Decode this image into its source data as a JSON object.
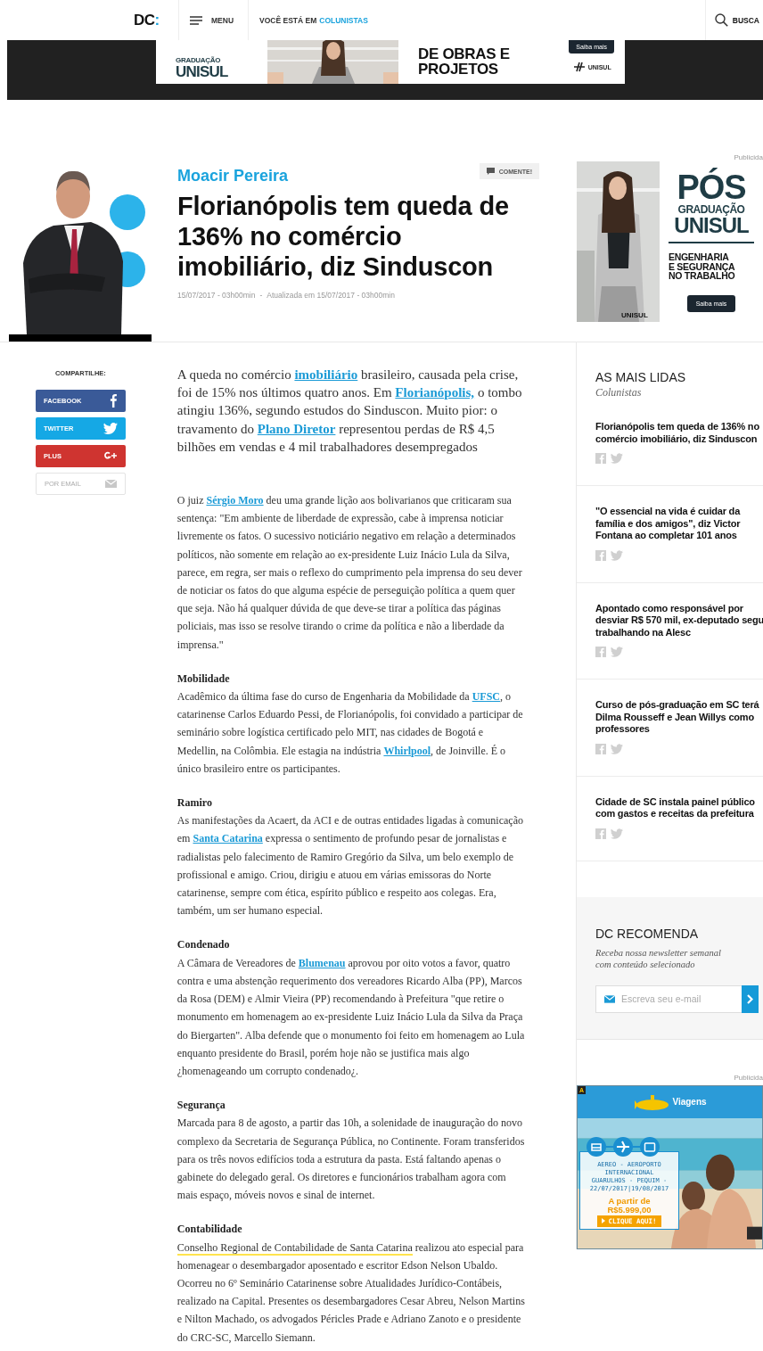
{
  "top_nav": {
    "logo": "DC",
    "logo_mark": ":",
    "menu": "MENU",
    "breadcrumb_prefix": "VOCÊ ESTÁ EM",
    "breadcrumb": "COLUNISTAS",
    "search": "BUSCA"
  },
  "top_banner": {
    "school_lines": [
      "GRADUAÇÃO",
      "UNISUL"
    ],
    "headline_lines": [
      "DE OBRAS E",
      "PROJETOS"
    ],
    "button": "Saiba mais",
    "brand": "UNISUL"
  },
  "article_header": {
    "author": "Moacir Pereira",
    "comment_button": "COMENTE!",
    "title": "Florianópolis tem queda de 136% no comércio imobiliário, diz Sinduscon",
    "published": "15/07/2017 - 03h00min",
    "separator": "-",
    "updated": "Atualizada em 15/07/2017 - 03h00min"
  },
  "side_ad": {
    "label": "Publicida",
    "big": "PÓS",
    "lines": [
      "GRADUAÇÃO",
      "UNISUL"
    ],
    "subtitle_lines": [
      "ENGENHARIA",
      "E SEGURANÇA",
      "NO TRABALHO"
    ],
    "button": "Saiba mais",
    "brand": "UNISUL"
  },
  "share": {
    "title": "COMPARTILHE:",
    "buttons": [
      {
        "label": "FACEBOOK",
        "kind": "facebook"
      },
      {
        "label": "TWITTER",
        "kind": "twitter"
      },
      {
        "label": "PLUS",
        "kind": "plus"
      },
      {
        "label": "POR EMAIL",
        "kind": "email"
      }
    ]
  },
  "article": {
    "lead": [
      {
        "kind": "text",
        "text": "A queda no comércio "
      },
      {
        "kind": "link",
        "text": "imobiliário"
      },
      {
        "kind": "text",
        "text": " brasileiro, causada pela crise, foi de 15% nos últimos quatro anos. Em "
      },
      {
        "kind": "link",
        "text": "Florianópolis,"
      },
      {
        "kind": "text",
        "text": " o tombo atingiu 136%, segundo estudos do Sinduscon. Muito pior: o travamento do "
      },
      {
        "kind": "link",
        "text": "Plano Diretor"
      },
      {
        "kind": "text",
        "text": " representou perdas de R$ 4,5 bilhões em vendas e 4 mil trabalhadores desempregados"
      }
    ],
    "sections": [
      {
        "parts": [
          {
            "kind": "text",
            "text": "O juiz "
          },
          {
            "kind": "link",
            "text": "Sérgio Moro"
          },
          {
            "kind": "text",
            "text": " deu uma grande lição aos bolivarianos que criticaram sua sentença: \"Em ambiente de liberdade de expressão, cabe à imprensa noticiar livremente os fatos. O sucessivo noticiário negativo em relação a determinados políticos, não somente em relação ao ex-presidente Luiz Inácio Lula da Silva, parece, em regra, ser mais o reflexo do cumprimento pela imprensa do seu dever de noticiar os fatos do que alguma espécie de perseguição política a quem quer que seja. Não há qualquer dúvida de que deve-se tirar a política das páginas policiais, mas isso se resolve tirando o crime da política e não a liberdade da imprensa.\""
          }
        ]
      },
      {
        "heading": "Mobilidade",
        "parts": [
          {
            "kind": "text",
            "text": "Acadêmico da última fase do curso de Engenharia da Mobilidade da "
          },
          {
            "kind": "link",
            "text": "UFSC"
          },
          {
            "kind": "text",
            "text": ", o catarinense Carlos Eduardo Pessi, de Florianópolis, foi convidado a participar de seminário sobre logística certificado pelo MIT, nas cidades de Bogotá e Medellin, na Colômbia. Ele estagia na indústria "
          },
          {
            "kind": "link",
            "text": "Whirlpool"
          },
          {
            "kind": "text",
            "text": ", de Joinville. É o único brasileiro entre os participantes."
          }
        ]
      },
      {
        "heading": "Ramiro",
        "parts": [
          {
            "kind": "text",
            "text": "As manifestações da Acaert, da ACI e de outras entidades ligadas à comunicação em "
          },
          {
            "kind": "link",
            "text": "Santa Catarina"
          },
          {
            "kind": "text",
            "text": " expressa o sentimento de profundo pesar de jornalistas e radialistas pelo falecimento de Ramiro Gregório da Silva, um belo exemplo de profissional e amigo. Criou, dirigiu e atuou em várias emissoras do Norte catarinense, sempre com ética, espírito público e respeito aos colegas. Era, também, um ser humano especial."
          }
        ]
      },
      {
        "heading": "Condenado",
        "parts": [
          {
            "kind": "text",
            "text": "A Câmara de Vereadores de "
          },
          {
            "kind": "link",
            "text": "Blumenau"
          },
          {
            "kind": "text",
            "text": " aprovou por oito votos a favor, quatro contra e uma abstenção requerimento dos vereadores Ricardo Alba (PP), Marcos da Rosa (DEM) e Almir Vieira (PP) recomendando à Prefeitura \"que retire o monumento em homenagem ao ex-presidente Luiz Inácio Lula da Silva da Praça do Biergarten\". Alba defende que o monumento foi feito em homenagem ao Lula enquanto presidente do Brasil, porém hoje não se justifica mais algo ¿homenageando um corrupto condenado¿."
          }
        ]
      },
      {
        "heading": "Segurança",
        "parts": [
          {
            "kind": "text",
            "text": "Marcada para 8 de agosto, a partir das 10h, a solenidade de inauguração do novo complexo da Secretaria de Segurança Pública, no Continente. Foram transferidos para os três novos edifícios toda a estrutura da pasta. Está faltando apenas o gabinete do delegado geral. Os diretores e funcionários trabalham agora com mais espaço, móveis novos e sinal de internet."
          }
        ]
      },
      {
        "heading": "Contabilidade",
        "parts": [
          {
            "kind": "highlight",
            "text": "Conselho Regional de Contabilidade de Santa Catarina"
          },
          {
            "kind": "text",
            "text": " realizou ato especial para homenagear o desembargador aposentado e escritor Edson Nelson Ubaldo. Ocorreu no 6º Seminário Catarinense sobre Atualidades Jurídico-Contábeis, realizado na Capital. Presentes os desembargadores Cesar Abreu, Nelson Martins e Nilton Machado, os advogados Péricles Prade e Adriano Zanoto e o presidente do CRC-SC, Marcello Siemann."
          }
        ]
      }
    ]
  },
  "most_read": {
    "title": "AS MAIS LIDAS",
    "subtitle": "Colunistas",
    "items": [
      {
        "lines": [
          "Florianópolis tem queda de 136% no",
          "comércio imobiliário, diz Sinduscon"
        ]
      },
      {
        "lines": [
          "\"O essencial na vida é cuidar da",
          "família e dos amigos\", diz  Victor",
          "Fontana ao completar 101 anos"
        ]
      },
      {
        "lines": [
          "Apontado como responsável por",
          "desviar R$ 570 mil, ex-deputado segu",
          "trabalhando na Alesc"
        ]
      },
      {
        "lines": [
          "Curso de pós-graduação em SC terá",
          "Dilma Rousseff e Jean Willys como",
          "professores"
        ]
      },
      {
        "lines": [
          "Cidade de SC instala painel público",
          "com gastos e receitas da prefeitura"
        ]
      }
    ]
  },
  "newsletter": {
    "title": "DC RECOMENDA",
    "text_lines": [
      "Receba nossa newsletter semanal",
      "com conteúdo selecionado"
    ],
    "placeholder": "Escreva seu e-mail"
  },
  "travel_ad": {
    "label": "Publicida",
    "badge": "A",
    "brand": "Viagens",
    "offer_lines": [
      "AEREO - AEROPORTO",
      "INTERNACIONAL",
      "GUARULHOS - PEQUIM -",
      "22/07/2017|19/08/2017"
    ],
    "price_label": "A partir de",
    "price": "R$5.999,00",
    "cta": "CLIQUE AQUI!"
  }
}
